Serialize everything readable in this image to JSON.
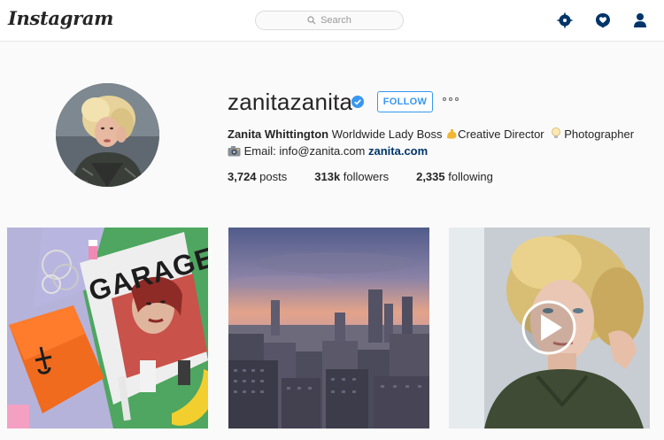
{
  "nav": {
    "logo": "Instagram",
    "search_placeholder": "Search",
    "icons": [
      "explore-compass-icon",
      "activity-heart-icon",
      "profile-person-icon"
    ]
  },
  "profile": {
    "username": "zanitazanita",
    "follow_label": "FOLLOW",
    "full_name": "Zanita Whittington",
    "bio_line1": "Worldwide Lady Boss",
    "bio_role": "Creative Director",
    "bio_role2": "Photographer",
    "email_text": "Email: info@zanita.com",
    "website": "zanita.com",
    "stats": {
      "posts_count": "3,724",
      "posts_label": "posts",
      "followers_count": "313k",
      "followers_label": "followers",
      "following_count": "2,335",
      "following_label": "following"
    }
  },
  "posts": [
    {
      "kind": "image",
      "magazine_text": "GARAGE"
    },
    {
      "kind": "image"
    },
    {
      "kind": "video"
    }
  ],
  "colors": {
    "link_blue": "#3897f0",
    "dark_link": "#003569",
    "border": "#dbdbdb"
  }
}
